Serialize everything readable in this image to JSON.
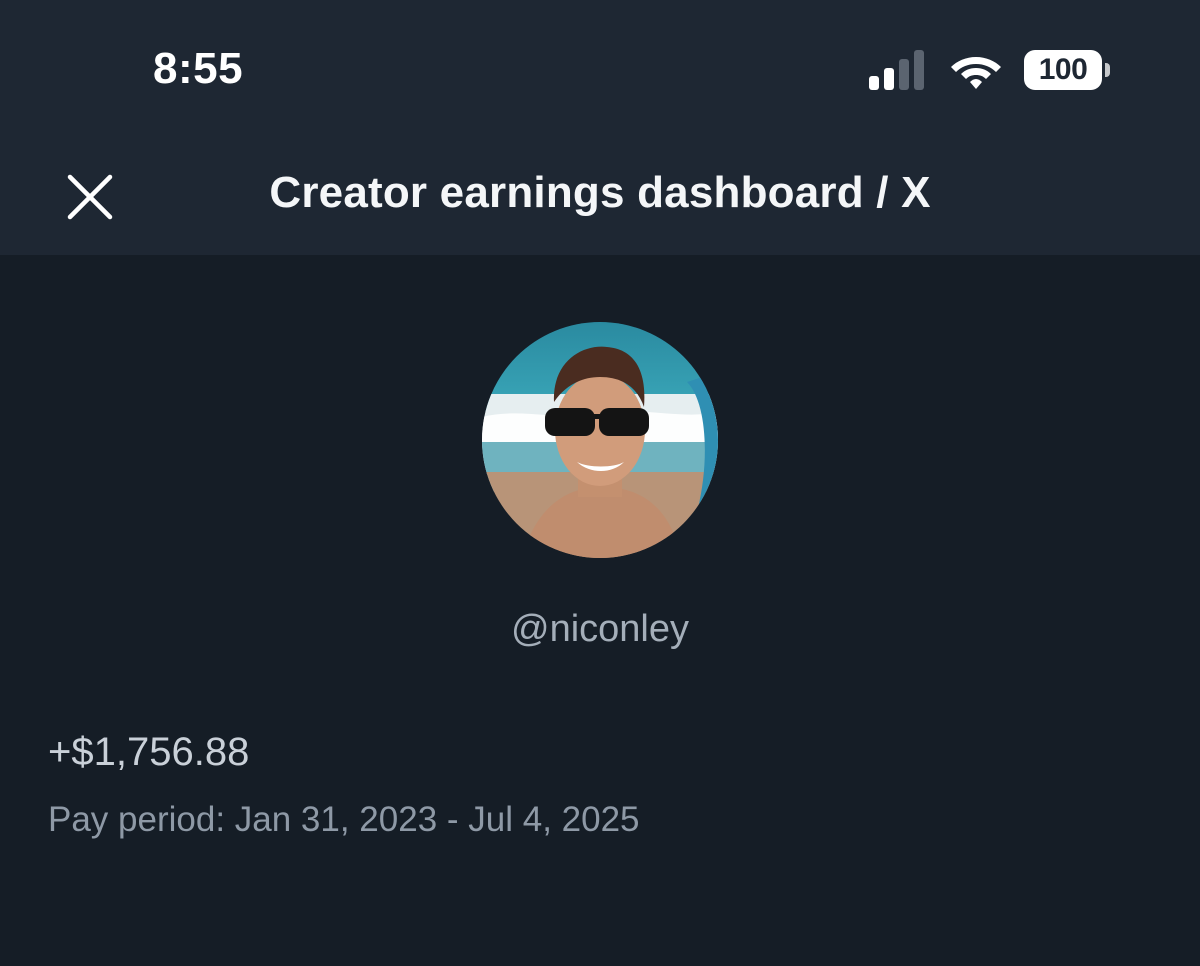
{
  "status_bar": {
    "time": "8:55",
    "battery": "100",
    "icons": [
      "signal-icon",
      "wifi-icon",
      "battery-icon"
    ]
  },
  "header": {
    "title": "Creator earnings dashboard / X",
    "close_icon": "close-icon"
  },
  "profile": {
    "username": "@niconley",
    "avatar": "profile-photo"
  },
  "earnings": {
    "amount": "+$1,756.88",
    "pay_period": "Pay period: Jan 31, 2023 - Jul 4, 2025"
  },
  "colors": {
    "background": "#151d26",
    "header_background": "#1e2733",
    "title_text": "#f4f6f8",
    "secondary_text": "#8e99a6"
  }
}
